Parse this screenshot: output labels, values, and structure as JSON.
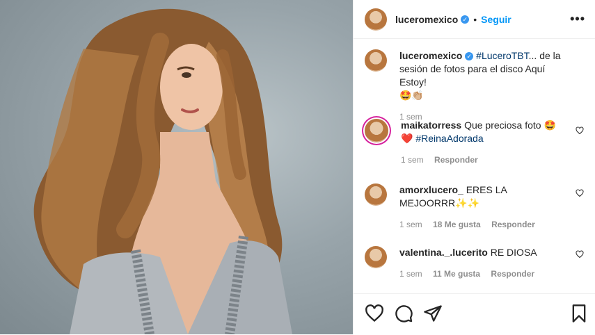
{
  "post": {
    "username": "luceromexico",
    "follow_label": "Seguir",
    "more_label": "•••",
    "separator": "•",
    "caption": {
      "hashtag": "#LuceroTBT",
      "text": "... de la sesión de fotos para el disco Aquí Estoy!",
      "emoji": "🤩👏🏼",
      "time": "1 sem"
    },
    "comments": [
      {
        "user": "maikatorress",
        "text": "Que preciosa foto 🤩",
        "line2_emoji": "❤️",
        "hashtag": "#ReinaAdorada",
        "time": "1 sem",
        "likes": "",
        "reply": "Responder"
      },
      {
        "user": "amorxlucero_",
        "text": "ERES LA MEJOORRR✨✨",
        "time": "1 sem",
        "likes": "18 Me gusta",
        "reply": "Responder"
      },
      {
        "user": "valentina._.lucerito",
        "text": "RE DIOSA",
        "time": "1 sem",
        "likes": "11 Me gusta",
        "reply": "Responder"
      }
    ]
  },
  "icons": [
    "verified-badge-icon",
    "heart-icon",
    "comment-icon",
    "share-icon",
    "save-icon",
    "more-options-icon"
  ],
  "colors": {
    "accent": "#0095f6",
    "verified": "#3897f0",
    "muted": "#8e8e8e",
    "hashtag": "#00376b",
    "heart_red": "#e0245e"
  }
}
